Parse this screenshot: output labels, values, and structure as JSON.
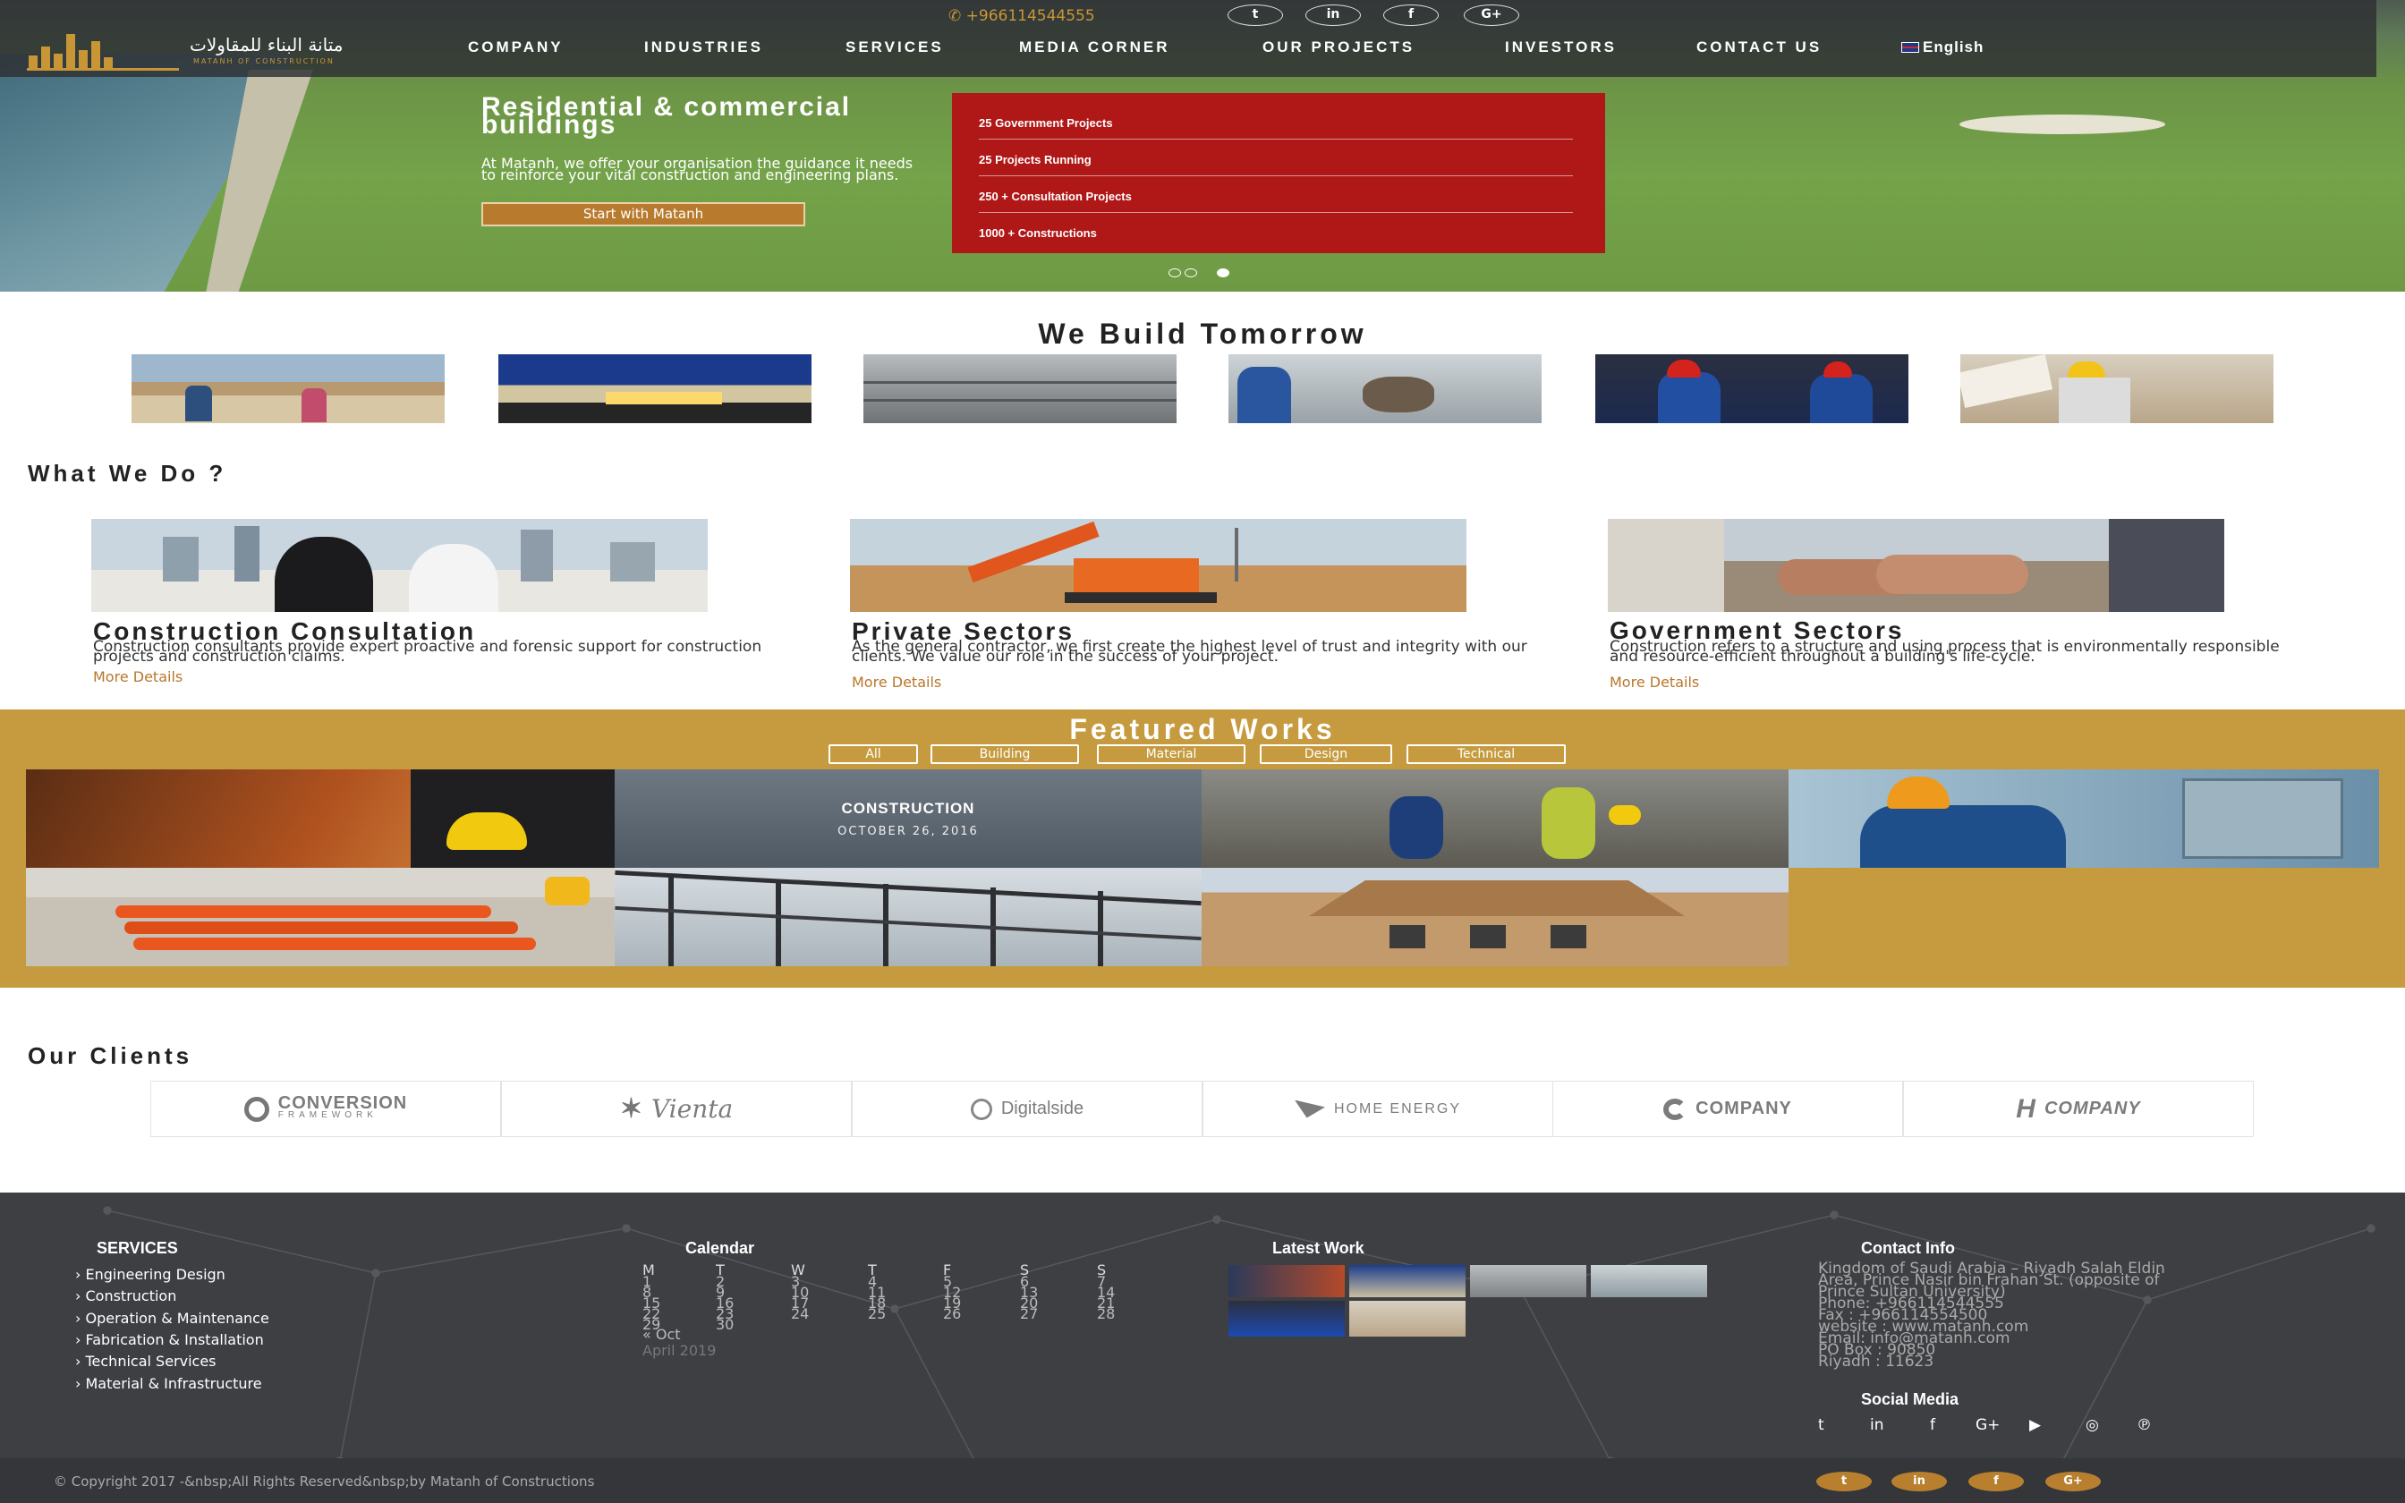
{
  "header": {
    "phone": "+966114544555",
    "nav": [
      "COMPANY",
      "INDUSTRIES",
      "SERVICES",
      "MEDIA CORNER",
      "OUR PROJECTS",
      "INVESTORS",
      "CONTACT US"
    ],
    "language": "English",
    "logo_arabic": "متانة البناء للمقاولات",
    "logo_latin": "MATANH OF CONSTRUCTION",
    "social": [
      "t",
      "in",
      "f",
      "G+"
    ]
  },
  "hero": {
    "title": "Residential & commercial buildings",
    "text": "At Matanh, we offer your organisation the guidance it needs to reinforce your vital construction and engineering plans.",
    "button": "Start with Matanh",
    "stats": [
      "25 Government Projects",
      "25 Projects Running",
      "250 + Consultation Projects",
      "1000 + Constructions"
    ],
    "slides": 3,
    "active_slide": 3
  },
  "build": {
    "title": "We Build Tomorrow"
  },
  "wwd": {
    "title": "What We Do ?",
    "items": [
      {
        "title": "Construction Consultation",
        "text": "Construction consultants provide expert proactive and forensic support for construction projects and construction claims.",
        "more": "More Details"
      },
      {
        "title": "Private Sectors",
        "text": "As the general contractor, we first create the highest level of trust and integrity with our clients. We value our role in the success of your project.",
        "more": "More Details"
      },
      {
        "title": "Government Sectors",
        "text": "Construction refers to a structure and using process that is environmentally responsible and resource-efficient throughout a building's life-cycle.",
        "more": "More Details"
      }
    ]
  },
  "featured": {
    "title": "Featured Works",
    "filters": [
      "All",
      "Building",
      "Material",
      "Design",
      "Technical"
    ],
    "overlay_title": "CONSTRUCTION",
    "overlay_date": "OCTOBER 26, 2016"
  },
  "clients": {
    "title": "Our Clients",
    "logos": [
      {
        "name": "CONVERSION",
        "sub": "FRAMEWORK"
      },
      {
        "name": "Vienta",
        "sub": ""
      },
      {
        "name": "Digitalside",
        "sub": ""
      },
      {
        "name": "HOME ENERGY",
        "sub": ""
      },
      {
        "name": "COMPANY",
        "sub": ""
      },
      {
        "name": "COMPANY",
        "sub": ""
      }
    ]
  },
  "footer": {
    "services_title": "SERVICES",
    "services": [
      "Engineering Design",
      "Construction",
      "Operation & Maintenance",
      "Fabrication & Installation",
      "Technical Services",
      "Material & Infrastructure"
    ],
    "calendar_title": "Calendar",
    "calendar_days": [
      "M",
      "T",
      "W",
      "T",
      "F",
      "S",
      "S"
    ],
    "calendar_weeks": [
      [
        "1",
        "2",
        "3",
        "4",
        "5",
        "6",
        "7"
      ],
      [
        "8",
        "9",
        "10",
        "11",
        "12",
        "13",
        "14"
      ],
      [
        "15",
        "16",
        "17",
        "18",
        "19",
        "20",
        "21"
      ],
      [
        "22",
        "23",
        "24",
        "25",
        "26",
        "27",
        "28"
      ],
      [
        "29",
        "30",
        "",
        "",
        "",
        "",
        ""
      ]
    ],
    "calendar_prev": "« Oct",
    "calendar_caption": "April 2019",
    "latest_title": "Latest Work",
    "contact_title": "Contact Info",
    "contact_lines": [
      "Kingdom of Saudi Arabia – Riyadh Salah Eldin",
      "Area, Prince Nasir bin Frahan St. (opposite of",
      "Prince Sultan University)",
      "Phone: +966114544555",
      "Fax : +966114554500",
      "website : www.matanh.com",
      "Email: info@matanh.com",
      "PO Box : 90850",
      "Riyadh : 11623"
    ],
    "social_title": "Social Media",
    "copyright": "© Copyright 2017 -&nbsp;All Rights Reserved&nbsp;by Matanh of Constructions",
    "bottom_social": [
      "t",
      "in",
      "f",
      "G+"
    ]
  },
  "colors": {
    "gold": "#c69b3f",
    "red": "#b01717",
    "footer": "#3d3f43",
    "accent": "#b9772a"
  }
}
